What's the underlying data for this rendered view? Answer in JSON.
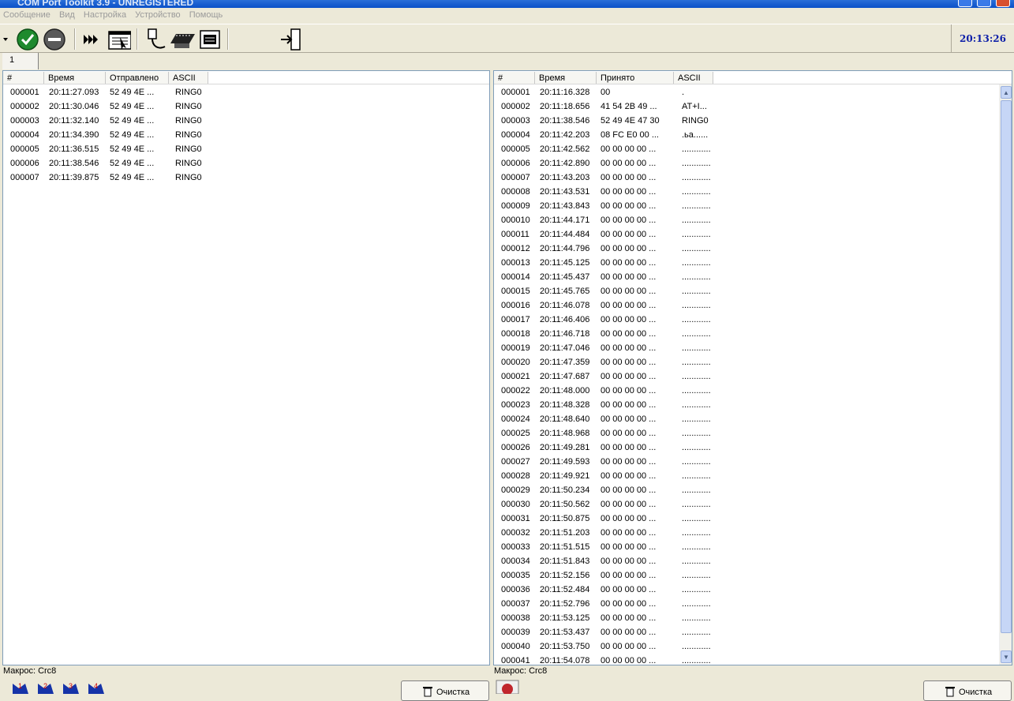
{
  "window": {
    "title": "COM Port Toolkit 3.9 - UNREGISTERED"
  },
  "menu": [
    "Сообщение",
    "Вид",
    "Настройка",
    "Устройство",
    "Помощь"
  ],
  "toolbar": {
    "clock": "20:13:26"
  },
  "tabs": [
    "1"
  ],
  "sent": {
    "columns": [
      "#",
      "Время",
      "Отправлено",
      "ASCII"
    ],
    "rows": [
      [
        "000001",
        "20:11:27.093",
        "52 49 4E ...",
        "RING0"
      ],
      [
        "000002",
        "20:11:30.046",
        "52 49 4E ...",
        "RING0"
      ],
      [
        "000003",
        "20:11:32.140",
        "52 49 4E ...",
        "RING0"
      ],
      [
        "000004",
        "20:11:34.390",
        "52 49 4E ...",
        "RING0"
      ],
      [
        "000005",
        "20:11:36.515",
        "52 49 4E ...",
        "RING0"
      ],
      [
        "000006",
        "20:11:38.546",
        "52 49 4E ...",
        "RING0"
      ],
      [
        "000007",
        "20:11:39.875",
        "52 49 4E ...",
        "RING0"
      ]
    ],
    "status": "Макрос: Crc8",
    "clear_label": "Очистка"
  },
  "received": {
    "columns": [
      "#",
      "Время",
      "Принято",
      "ASCII"
    ],
    "rows": [
      [
        "000001",
        "20:11:16.328",
        "00",
        "."
      ],
      [
        "000002",
        "20:11:18.656",
        "41 54 2B 49 ...",
        "AT+I..."
      ],
      [
        "000003",
        "20:11:38.546",
        "52 49 4E 47 30",
        "RING0"
      ],
      [
        "000004",
        "20:11:42.203",
        "08 FC E0 00 ...",
        ".ьа......"
      ],
      [
        "000005",
        "20:11:42.562",
        "00 00 00 00 ...",
        "............"
      ],
      [
        "000006",
        "20:11:42.890",
        "00 00 00 00 ...",
        "............"
      ],
      [
        "000007",
        "20:11:43.203",
        "00 00 00 00 ...",
        "............"
      ],
      [
        "000008",
        "20:11:43.531",
        "00 00 00 00 ...",
        "............"
      ],
      [
        "000009",
        "20:11:43.843",
        "00 00 00 00 ...",
        "............"
      ],
      [
        "000010",
        "20:11:44.171",
        "00 00 00 00 ...",
        "............"
      ],
      [
        "000011",
        "20:11:44.484",
        "00 00 00 00 ...",
        "............"
      ],
      [
        "000012",
        "20:11:44.796",
        "00 00 00 00 ...",
        "............"
      ],
      [
        "000013",
        "20:11:45.125",
        "00 00 00 00 ...",
        "............"
      ],
      [
        "000014",
        "20:11:45.437",
        "00 00 00 00 ...",
        "............"
      ],
      [
        "000015",
        "20:11:45.765",
        "00 00 00 00 ...",
        "............"
      ],
      [
        "000016",
        "20:11:46.078",
        "00 00 00 00 ...",
        "............"
      ],
      [
        "000017",
        "20:11:46.406",
        "00 00 00 00 ...",
        "............"
      ],
      [
        "000018",
        "20:11:46.718",
        "00 00 00 00 ...",
        "............"
      ],
      [
        "000019",
        "20:11:47.046",
        "00 00 00 00 ...",
        "............"
      ],
      [
        "000020",
        "20:11:47.359",
        "00 00 00 00 ...",
        "............"
      ],
      [
        "000021",
        "20:11:47.687",
        "00 00 00 00 ...",
        "............"
      ],
      [
        "000022",
        "20:11:48.000",
        "00 00 00 00 ...",
        "............"
      ],
      [
        "000023",
        "20:11:48.328",
        "00 00 00 00 ...",
        "............"
      ],
      [
        "000024",
        "20:11:48.640",
        "00 00 00 00 ...",
        "............"
      ],
      [
        "000025",
        "20:11:48.968",
        "00 00 00 00 ...",
        "............"
      ],
      [
        "000026",
        "20:11:49.281",
        "00 00 00 00 ...",
        "............"
      ],
      [
        "000027",
        "20:11:49.593",
        "00 00 00 00 ...",
        "............"
      ],
      [
        "000028",
        "20:11:49.921",
        "00 00 00 00 ...",
        "............"
      ],
      [
        "000029",
        "20:11:50.234",
        "00 00 00 00 ...",
        "............"
      ],
      [
        "000030",
        "20:11:50.562",
        "00 00 00 00 ...",
        "............"
      ],
      [
        "000031",
        "20:11:50.875",
        "00 00 00 00 ...",
        "............"
      ],
      [
        "000032",
        "20:11:51.203",
        "00 00 00 00 ...",
        "............"
      ],
      [
        "000033",
        "20:11:51.515",
        "00 00 00 00 ...",
        "............"
      ],
      [
        "000034",
        "20:11:51.843",
        "00 00 00 00 ...",
        "............"
      ],
      [
        "000035",
        "20:11:52.156",
        "00 00 00 00 ...",
        "............"
      ],
      [
        "000036",
        "20:11:52.484",
        "00 00 00 00 ...",
        "............"
      ],
      [
        "000037",
        "20:11:52.796",
        "00 00 00 00 ...",
        "............"
      ],
      [
        "000038",
        "20:11:53.125",
        "00 00 00 00 ...",
        "............"
      ],
      [
        "000039",
        "20:11:53.437",
        "00 00 00 00 ...",
        "............"
      ],
      [
        "000040",
        "20:11:53.750",
        "00 00 00 00 ...",
        "............"
      ],
      [
        "000041",
        "20:11:54.078",
        "00 00 00 00 ...",
        "............"
      ]
    ],
    "status": "Макрос: Crc8",
    "clear_label": "Очистка"
  }
}
